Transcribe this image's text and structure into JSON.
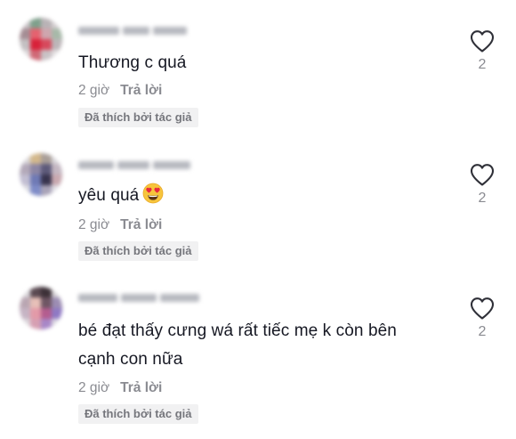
{
  "comments": [
    {
      "text": "Thương c quá",
      "time": "2 giờ",
      "reply_label": "Trả lời",
      "badge": "Đã thích bởi tác giả",
      "like_count": "2"
    },
    {
      "text": "yêu quá",
      "emoji": "heart-eyes-emoji",
      "time": "2 giờ",
      "reply_label": "Trả lời",
      "badge": "Đã thích bởi tác giả",
      "like_count": "2"
    },
    {
      "text_line1": "bé đạt thấy cưng wá rất tiếc mẹ k còn bên",
      "text_line2": "cạnh con nữa",
      "time": "2 giờ",
      "reply_label": "Trả lời",
      "badge": "Đã thích bởi tác giả",
      "like_count": "2"
    }
  ],
  "icons": {
    "like": "heart-outline-icon"
  },
  "colors": {
    "text_primary": "#161823",
    "text_secondary": "#8a8b91",
    "badge_bg": "#f1f1f2",
    "badge_text": "#75767c"
  }
}
